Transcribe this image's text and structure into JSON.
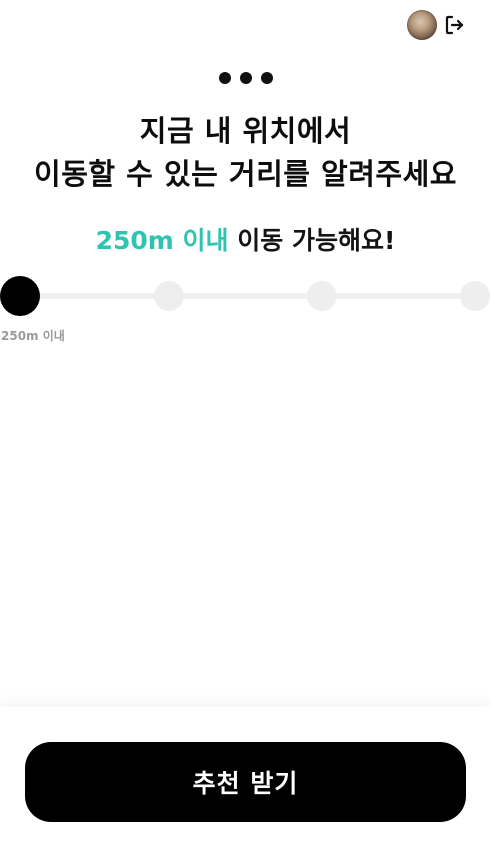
{
  "header": {
    "avatar_icon": "user-avatar",
    "logout_icon": "logout-icon"
  },
  "step_indicator": {
    "icon": "three-dots-icon",
    "count": 3
  },
  "title": {
    "line1": "지금 내 위치에서",
    "line2": "이동할 수 있는 거리를 알려주세요"
  },
  "subtitle": {
    "highlight": "250m 이내",
    "rest": " 이동 가능해요!"
  },
  "distance_slider": {
    "selected_label": "250m 이내",
    "stops_count": 4,
    "selected_index": 0
  },
  "cta": {
    "label": "추천 받기"
  },
  "colors": {
    "accent": "#2ec4b0",
    "primary": "#000000",
    "track": "#f0f0f0",
    "muted_text": "#9a9a9a"
  }
}
